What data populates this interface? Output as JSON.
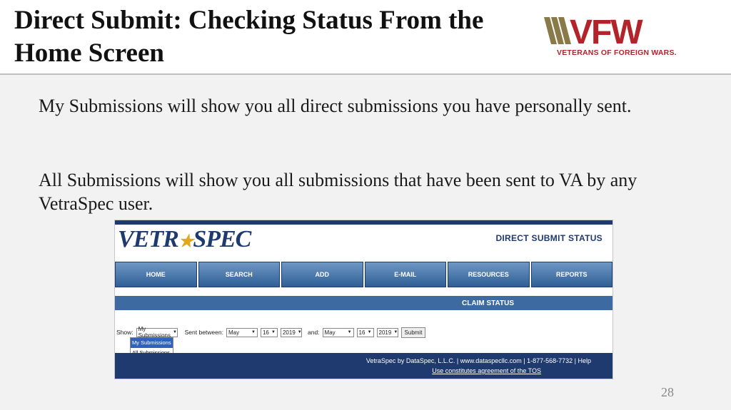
{
  "slide": {
    "title": "Direct Submit: Checking Status From the Home Screen",
    "paragraphs": [
      "My Submissions will show you all direct submissions you have personally sent.",
      "All Submissions will show you all submissions that have been sent to VA by any VetraSpec user."
    ],
    "page_number": "28"
  },
  "logo": {
    "mark": "VFW",
    "tagline": "VETERANS OF FOREIGN WARS.",
    "color": "#b3232a",
    "stripe_color": "#8a7a4a"
  },
  "app": {
    "logo_text_left": "VETR",
    "logo_text_right": "SPEC",
    "page_heading": "DIRECT SUBMIT STATUS",
    "nav": [
      "HOME",
      "SEARCH",
      "ADD",
      "E-MAIL",
      "RESOURCES",
      "REPORTS"
    ],
    "section_bar": "CLAIM STATUS",
    "filters": {
      "show_label": "Show:",
      "show_value": "My Submissions",
      "sent_between_label": "Sent between:",
      "from_month": "May",
      "from_day": "16",
      "from_year": "2019",
      "and_label": "and:",
      "to_month": "May",
      "to_day": "16",
      "to_year": "2019",
      "submit_label": "Submit"
    },
    "show_options": [
      "My Submissions",
      "All Submissions"
    ],
    "footer_line1": "VetraSpec by DataSpec, L.L.C. | www.dataspecllc.com | 1-877-568-7732 | Help",
    "footer_line2": "Use constitutes agreement of the TOS"
  }
}
